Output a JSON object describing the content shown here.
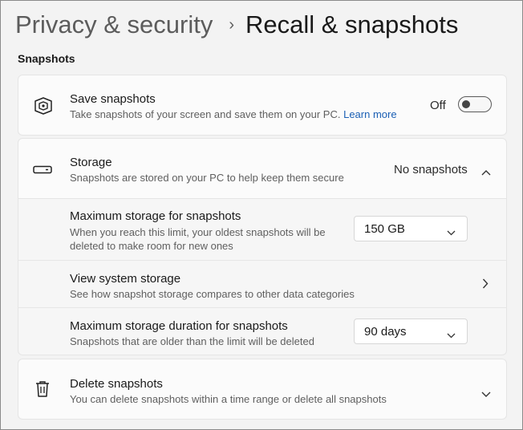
{
  "breadcrumb": {
    "parent": "Privacy & security",
    "separator": "›",
    "current": "Recall & snapshots"
  },
  "section": {
    "label": "Snapshots"
  },
  "save_snapshots": {
    "icon": "recall-icon",
    "title": "Save snapshots",
    "description": "Take snapshots of your screen and save them on your PC.",
    "link": "Learn more",
    "state_label": "Off",
    "toggle_on": false
  },
  "storage": {
    "icon": "storage-drive-icon",
    "title": "Storage",
    "description": "Snapshots are stored on your PC to help keep them secure",
    "status": "No snapshots",
    "expanded": true,
    "max_storage": {
      "title": "Maximum storage for snapshots",
      "description_line1": "When you reach this limit, your oldest snapshots will be",
      "description_line2": "deleted to make room for new ones",
      "selected": "150 GB"
    },
    "view_system_storage": {
      "title": "View system storage",
      "description": "See how snapshot storage compares to other data categories"
    },
    "max_duration": {
      "title": "Maximum storage duration for snapshots",
      "description": "Snapshots that are older than the limit will be deleted",
      "selected": "90 days"
    }
  },
  "delete_snapshots": {
    "icon": "trash-icon",
    "title": "Delete snapshots",
    "description": "You can delete snapshots within a time range or delete all snapshots"
  }
}
